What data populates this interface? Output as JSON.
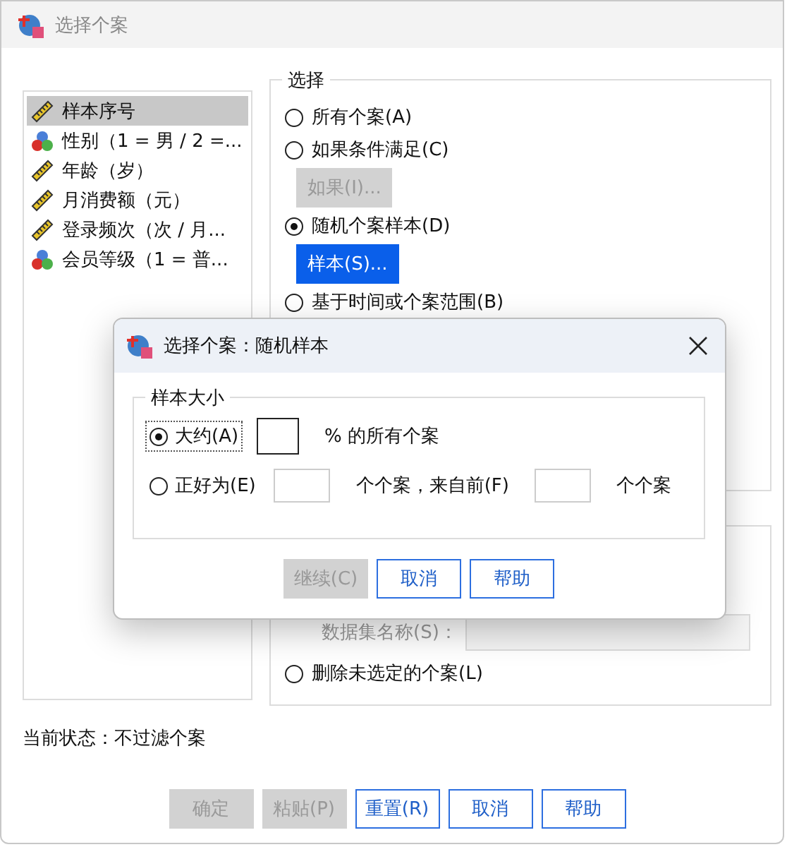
{
  "window": {
    "title": "选择个案"
  },
  "variables": [
    {
      "label": "样本序号",
      "kind": "scale",
      "selected": true
    },
    {
      "label": "性别（1 = 男 / 2 =...",
      "kind": "nominal",
      "selected": false
    },
    {
      "label": "年龄（岁）",
      "kind": "scale",
      "selected": false
    },
    {
      "label": "月消费额（元）",
      "kind": "scale",
      "selected": false
    },
    {
      "label": "登录频次（次 / 月...",
      "kind": "scale",
      "selected": false
    },
    {
      "label": "会员等级（1 = 普...",
      "kind": "nominal",
      "selected": false
    }
  ],
  "select_group": {
    "title": "选择",
    "items": [
      {
        "kind": "radio",
        "label": "所有个案(A)",
        "selected": false
      },
      {
        "kind": "radio",
        "label": "如果条件满足(C)",
        "selected": false
      },
      {
        "kind": "button",
        "label": "如果(I)...",
        "disabled": true,
        "focused": false
      },
      {
        "kind": "radio",
        "label": "随机个案样本(D)",
        "selected": true
      },
      {
        "kind": "button",
        "label": "样本(S)...",
        "disabled": false,
        "focused": true
      },
      {
        "kind": "radio",
        "label": "基于时间或个案范围(B)",
        "selected": false
      }
    ]
  },
  "output_group": {
    "dataset_name": {
      "label": "数据集名称(S)：",
      "disabled": true
    },
    "options": [
      {
        "label": "删除未选定的个案(L)",
        "selected": false
      }
    ]
  },
  "status": "当前状态：不过滤个案",
  "buttons": [
    {
      "label": "确定",
      "disabled": true
    },
    {
      "label": "粘贴(P)",
      "disabled": true
    },
    {
      "label": "重置(R)",
      "disabled": false
    },
    {
      "label": "取消",
      "disabled": false
    },
    {
      "label": "帮助",
      "disabled": false
    }
  ],
  "dialog": {
    "title": "选择个案：随机样本",
    "group_title": "样本大小",
    "rows": [
      {
        "label": "大约(A)",
        "selected": true,
        "parts": [
          {
            "kind": "field"
          },
          {
            "kind": "text",
            "text": "% 的所有个案"
          }
        ]
      },
      {
        "label": "正好为(E)",
        "selected": false,
        "parts": [
          {
            "kind": "field"
          },
          {
            "kind": "text",
            "text": "个个案，来自前(F)"
          },
          {
            "kind": "field"
          },
          {
            "kind": "text",
            "text": "个个案"
          }
        ]
      }
    ],
    "buttons": [
      {
        "label": "继续(C)",
        "disabled": true
      },
      {
        "label": "取消",
        "disabled": false
      },
      {
        "label": "帮助",
        "disabled": false
      }
    ]
  }
}
